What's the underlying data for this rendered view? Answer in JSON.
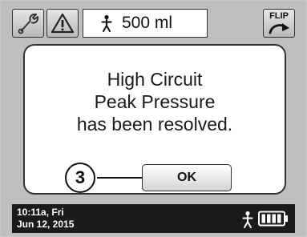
{
  "header": {
    "settings_icon": "wrench-icon",
    "alarm_icon": "warning-triangle-icon",
    "patient_icon": "person-icon",
    "volume": "500 ml",
    "flip_label": "FLIP",
    "flip_icon": "rotate-arrow-icon"
  },
  "dialog": {
    "lines": [
      "High Circuit",
      "Peak Pressure",
      "has been resolved."
    ],
    "callout_number": "3",
    "ok_label": "OK"
  },
  "footer": {
    "time": "10:11a, Fri",
    "date": "Jun 12, 2015",
    "person_icon": "person-icon",
    "battery_icon": "battery-icon"
  }
}
